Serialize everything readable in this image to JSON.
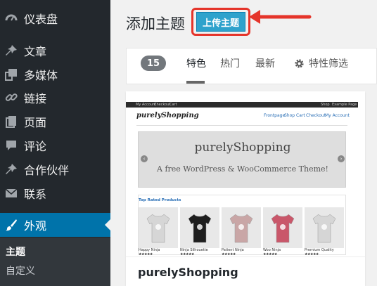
{
  "sidebar": {
    "items": [
      {
        "label": "仪表盘",
        "icon": "dashboard-icon"
      },
      {
        "label": "文章",
        "icon": "pushpin-icon"
      },
      {
        "label": "多媒体",
        "icon": "media-icon"
      },
      {
        "label": "链接",
        "icon": "link-icon"
      },
      {
        "label": "页面",
        "icon": "page-icon"
      },
      {
        "label": "评论",
        "icon": "comment-icon"
      },
      {
        "label": "合作伙伴",
        "icon": "pushpin-icon"
      },
      {
        "label": "联系",
        "icon": "mail-icon"
      },
      {
        "label": "外观",
        "icon": "paintbrush-icon"
      }
    ],
    "submenu": [
      "主题",
      "自定义"
    ]
  },
  "header": {
    "title": "添加主题",
    "upload_label": "上传主题"
  },
  "filter": {
    "count": "15",
    "tabs": [
      "特色",
      "热门",
      "最新"
    ],
    "feature_filter_label": "特性筛选"
  },
  "theme": {
    "name": "purelyShopping",
    "screenshot": {
      "topbar_left": [
        "My Account",
        "Checkout",
        "Cart"
      ],
      "topbar_right": [
        "Shop",
        "Example Page"
      ],
      "logo": "purelyShopping",
      "nav": [
        "Frontpage",
        "Shop",
        "Cart",
        "Checkout",
        "My Account"
      ],
      "hero_title": "purelyShopping",
      "hero_subtitle": "A free WordPress & WooCommerce Theme!",
      "section_title": "Top Rated Products",
      "products": [
        {
          "name": "Happy Ninja",
          "color": "#d6d6d6"
        },
        {
          "name": "Ninja Silhouette",
          "color": "#1e1e1e"
        },
        {
          "name": "Patient Ninja",
          "color": "#c9a6a6"
        },
        {
          "name": "Woo Ninja",
          "color": "#c9576a"
        },
        {
          "name": "Premium Quality",
          "color": "#d6d6d6"
        }
      ],
      "stars": "★★★★★"
    }
  },
  "colors": {
    "sidebar_bg": "#23282d",
    "active": "#0073aa",
    "button": "#2ea2cc",
    "annotation": "#e5342a"
  }
}
